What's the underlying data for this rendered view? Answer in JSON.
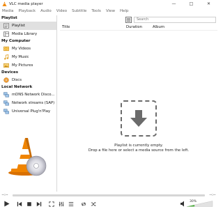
{
  "window": {
    "title": "VLC media player",
    "minimize_icon": "minimize-icon",
    "maximize_icon": "maximize-icon",
    "close_icon": "close-icon"
  },
  "menu": [
    "Media",
    "Playback",
    "Audio",
    "Video",
    "Subtitle",
    "Tools",
    "View",
    "Help"
  ],
  "sidebar": {
    "sections": [
      {
        "header": "Playlist",
        "items": [
          {
            "label": "Playlist",
            "icon": "playlist-icon",
            "selected": true
          },
          {
            "label": "Media Library",
            "icon": "media-library-icon"
          }
        ]
      },
      {
        "header": "My Computer",
        "items": [
          {
            "label": "My Videos",
            "icon": "videos-icon"
          },
          {
            "label": "My Music",
            "icon": "music-icon"
          },
          {
            "label": "My Pictures",
            "icon": "pictures-icon"
          }
        ]
      },
      {
        "header": "Devices",
        "items": [
          {
            "label": "Discs",
            "icon": "disc-icon"
          }
        ]
      },
      {
        "header": "Local Network",
        "items": [
          {
            "label": "mDNS Network Disco...",
            "icon": "network-icon"
          },
          {
            "label": "Network streams (SAP)",
            "icon": "network-icon"
          },
          {
            "label": "Universal Plug'n'Play",
            "icon": "network-icon"
          }
        ]
      }
    ]
  },
  "search": {
    "placeholder": "Search"
  },
  "playlist": {
    "columns": [
      "Title",
      "Duration",
      "Album"
    ],
    "empty_line1": "Playlist is currently empty.",
    "empty_line2": "Drop a file here or select a media source from the left."
  },
  "player": {
    "elapsed": "--:--",
    "remaining": "--:--",
    "volume_percent": "30%",
    "volume_level": 0.3
  },
  "colors": {
    "vlc_orange": "#f08400",
    "selected_bg": "#e0e0e0",
    "volume_green": "#4caf3c"
  }
}
